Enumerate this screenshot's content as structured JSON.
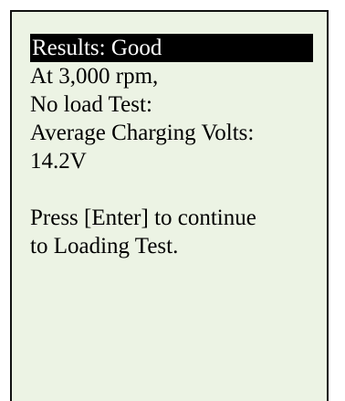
{
  "display": {
    "header": "Results: Good",
    "lines": [
      "At 3,000 rpm,",
      "No load Test:",
      "Average Charging Volts:",
      "14.2V"
    ],
    "instructions": [
      "Press [Enter] to continue",
      "to Loading Test."
    ]
  },
  "colors": {
    "screen_background": "#ecf3e4",
    "header_background": "#000000",
    "header_text": "#ffffff",
    "text": "#000000",
    "border": "#111111"
  }
}
